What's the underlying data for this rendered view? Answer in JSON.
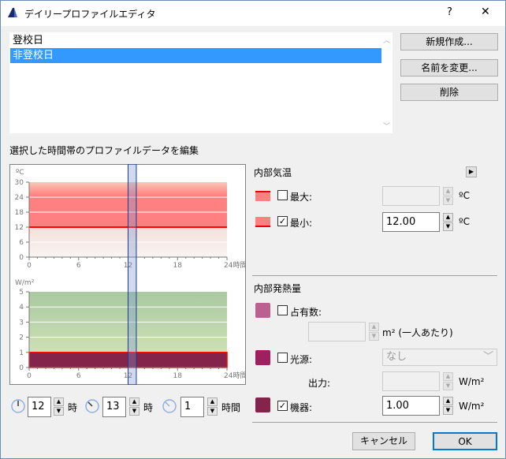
{
  "window": {
    "title": "デイリープロファイルエディタ",
    "help": "?",
    "close": "✕"
  },
  "profiles": [
    {
      "label": "登校日",
      "selected": false
    },
    {
      "label": "非登校日",
      "selected": true
    }
  ],
  "buttons": {
    "new": "新規作成...",
    "rename": "名前を変更...",
    "delete": "削除",
    "cancel": "キャンセル",
    "ok": "OK"
  },
  "section_label": "選択した時間帯のプロファイルデータを編集",
  "chart_data": [
    {
      "type": "area",
      "yunit": "ºC",
      "xunit": "時間",
      "xlim": [
        0,
        24
      ],
      "ylim": [
        0,
        30
      ],
      "xticks": [
        "0",
        "6",
        "12",
        "18",
        "24"
      ],
      "yticks": [
        "0",
        "6",
        "12",
        "18",
        "24",
        "30"
      ],
      "series": [
        {
          "name": "最小",
          "values": [
            12,
            12
          ],
          "x": [
            0,
            24
          ],
          "color": "#ff0000"
        }
      ],
      "selection": [
        12,
        13
      ]
    },
    {
      "type": "area",
      "yunit": "W/m²",
      "xunit": "時間",
      "xlim": [
        0,
        24
      ],
      "ylim": [
        0,
        5
      ],
      "xticks": [
        "0",
        "6",
        "12",
        "18",
        "24"
      ],
      "yticks": [
        "0",
        "1",
        "2",
        "3",
        "4",
        "5"
      ],
      "series": [
        {
          "name": "機器",
          "values": [
            1,
            1
          ],
          "x": [
            0,
            24
          ],
          "color": "#84244a"
        }
      ],
      "selection": [
        12,
        13
      ]
    }
  ],
  "time": {
    "start": "12",
    "start_unit": "時",
    "end": "13",
    "end_unit": "時",
    "duration": "1",
    "duration_unit": "時間"
  },
  "temp": {
    "title": "内部気温",
    "max_label": "最大:",
    "max_checked": false,
    "max_value": "",
    "min_label": "最小:",
    "min_checked": true,
    "min_value": "12.00",
    "unit": "ºC"
  },
  "heat": {
    "title": "内部発熱量",
    "occ_label": "占有数:",
    "occ_checked": false,
    "occ_value": "",
    "occ_unit": "m² (一人あたり)",
    "light_label": "光源:",
    "light_checked": false,
    "light_select": "なし",
    "output_label": "出力:",
    "output_value": "",
    "output_unit": "W/m²",
    "equip_label": "機器:",
    "equip_checked": true,
    "equip_value": "1.00",
    "equip_unit": "W/m²"
  },
  "colors": {
    "occ": "#bb6190",
    "light": "#a01f5e",
    "equip": "#84244a",
    "temp": "#ff8080",
    "accent": "#3399ff"
  }
}
